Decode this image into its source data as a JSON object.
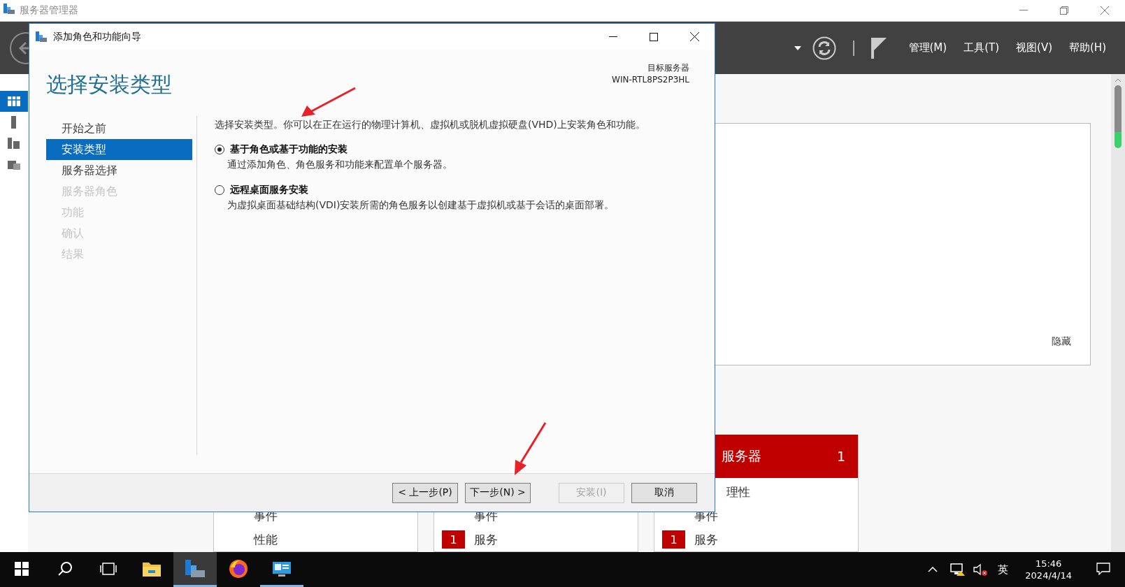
{
  "app_window": {
    "title": "服务器管理器"
  },
  "header": {
    "menu": [
      {
        "label": "管理(M)"
      },
      {
        "label": "工具(T)"
      },
      {
        "label": "视图(V)"
      },
      {
        "label": "帮助(H)"
      }
    ]
  },
  "side_nav": {
    "items": [
      {
        "selected": true
      },
      {
        "selected": false
      },
      {
        "selected": false
      },
      {
        "selected": false
      }
    ]
  },
  "welcome_panel": {
    "hide_link": "隐藏"
  },
  "tiles": [
    {
      "rows": [
        {
          "label": "事件"
        },
        {
          "label": "性能"
        }
      ]
    },
    {
      "rows": [
        {
          "label": "事件"
        },
        {
          "badge": "1",
          "label": "服务"
        }
      ]
    },
    {
      "title": "服务器",
      "count": "1",
      "rows": [
        {
          "kind": "partial",
          "label": "理性"
        },
        {
          "label": "事件"
        },
        {
          "badge": "1",
          "label": "服务"
        }
      ]
    }
  ],
  "dialog": {
    "title": "添加角色和功能向导",
    "heading": "选择安装类型",
    "target_label": "目标服务器",
    "target_server": "WIN-RTL8PS2P3HL",
    "steps": [
      {
        "label": "开始之前",
        "selected": false,
        "disabled": false
      },
      {
        "label": "安装类型",
        "selected": true,
        "disabled": false
      },
      {
        "label": "服务器选择",
        "selected": false,
        "disabled": false
      },
      {
        "label": "服务器角色",
        "selected": false,
        "disabled": true
      },
      {
        "label": "功能",
        "selected": false,
        "disabled": true
      },
      {
        "label": "确认",
        "selected": false,
        "disabled": true
      },
      {
        "label": "结果",
        "selected": false,
        "disabled": true
      }
    ],
    "intro": "选择安装类型。你可以在正在运行的物理计算机、虚拟机或脱机虚拟硬盘(VHD)上安装角色和功能。",
    "options": [
      {
        "label": "基于角色或基于功能的安装",
        "description": "通过添加角色、角色服务和功能来配置单个服务器。",
        "selected": true
      },
      {
        "label": "远程桌面服务安装",
        "description": "为虚拟桌面基础结构(VDI)安装所需的角色服务以创建基于虚拟机或基于会话的桌面部署。",
        "selected": false
      }
    ],
    "buttons": [
      {
        "label": "< 上一步(P)",
        "disabled": false
      },
      {
        "label": "下一步(N) >",
        "disabled": false
      },
      {
        "label": "安装(I)",
        "disabled": true
      },
      {
        "label": "取消",
        "disabled": false
      }
    ]
  },
  "taskbar": {
    "apps": [
      {
        "kind": "explorer",
        "active": false,
        "running": false
      },
      {
        "kind": "server_manager",
        "active": true,
        "running": true
      },
      {
        "kind": "firefox",
        "active": false,
        "running": false
      },
      {
        "kind": "control_panel",
        "active": false,
        "running": true
      }
    ],
    "tray": {
      "ime": "英",
      "time": "15:46",
      "date": "2024/4/14"
    }
  }
}
